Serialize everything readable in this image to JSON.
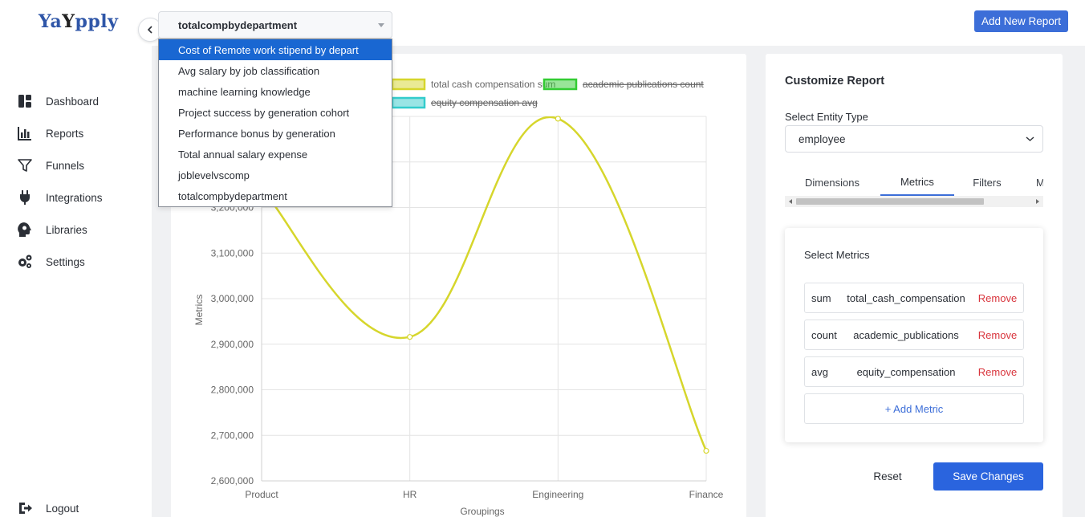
{
  "app": {
    "logo_parts": [
      "Ya",
      "Y",
      "pply"
    ]
  },
  "sidebar": {
    "items": [
      {
        "label": "Dashboard",
        "icon": "dashboard-icon"
      },
      {
        "label": "Reports",
        "icon": "bar-chart-icon"
      },
      {
        "label": "Funnels",
        "icon": "funnel-icon"
      },
      {
        "label": "Integrations",
        "icon": "plug-icon"
      },
      {
        "label": "Libraries",
        "icon": "head-gear-icon"
      },
      {
        "label": "Settings",
        "icon": "gears-icon"
      }
    ],
    "logout_label": "Logout"
  },
  "header": {
    "selected_report": "totalcompbydepartment",
    "add_report_label": "Add New Report"
  },
  "dropdown": {
    "options": [
      "Cost of Remote work stipend by depart",
      "Avg salary by job classification",
      "machine learning knowledge",
      "Project success by generation cohort",
      "Performance bonus by generation",
      "Total annual salary expense",
      "joblevelvscomp",
      "totalcompbydepartment"
    ],
    "highlighted_index": 0
  },
  "chart_data": {
    "type": "line",
    "categories": [
      "Product",
      "HR",
      "Engineering",
      "Finance"
    ],
    "series": [
      {
        "name": "total cash compensation sum",
        "values": [
          3240000,
          2916000,
          3395000,
          2666000
        ],
        "color": "#d6d62c",
        "hidden": false
      },
      {
        "name": "academic publications count",
        "values": [],
        "color": "#33cc33",
        "hidden": true
      },
      {
        "name": "equity compensation avg",
        "values": [],
        "color": "#33cccc",
        "hidden": true
      }
    ],
    "xlabel": "Groupings",
    "ylabel": "Metrics",
    "ylim": [
      2600000,
      3400000
    ],
    "yticks": [
      "2,600,000",
      "2,700,000",
      "2,800,000",
      "2,900,000",
      "3,000,000",
      "3,100,000",
      "3,200,000"
    ],
    "grid": true,
    "legend_position": "top"
  },
  "panel": {
    "title": "Customize Report",
    "entity_label": "Select Entity Type",
    "entity_value": "employee",
    "tabs": [
      "Dimensions",
      "Metrics",
      "Filters",
      "M"
    ],
    "active_tab": "Metrics",
    "metrics_title": "Select Metrics",
    "metrics": [
      {
        "agg": "sum",
        "field": "total_cash_compensation",
        "remove": "Remove"
      },
      {
        "agg": "count",
        "field": "academic_publications",
        "remove": "Remove"
      },
      {
        "agg": "avg",
        "field": "equity_compensation",
        "remove": "Remove"
      }
    ],
    "add_metric_label": "+ Add Metric",
    "reset_label": "Reset",
    "save_label": "Save Changes"
  }
}
